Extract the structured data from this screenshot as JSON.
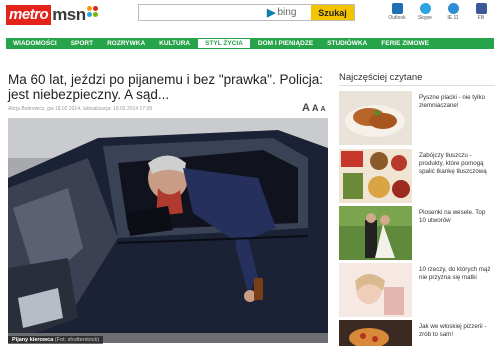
{
  "header": {
    "logo_part1": "metro",
    "logo_part2": "msn",
    "search_placeholder": "",
    "bing_label": "bing",
    "search_button": "Szukaj",
    "quick_links": [
      {
        "label": "Outlook",
        "icon": "outlook-icon",
        "color": "#1f6fb5"
      },
      {
        "label": "Skype",
        "icon": "skype-icon",
        "color": "#2ca4de"
      },
      {
        "label": "IE 11",
        "icon": "ie-icon",
        "color": "#2e8fd6"
      },
      {
        "label": "FB",
        "icon": "facebook-icon",
        "color": "#3b5998"
      }
    ]
  },
  "nav": {
    "items": [
      "WIADOMOŚCI",
      "SPORT",
      "ROZRYWKA",
      "KULTURA",
      "STYL ŻYCIA",
      "DOM I PIENIĄDZE",
      "STUDIÓWKA",
      "FERIE ZIMOWE"
    ],
    "active_index": 4,
    "color": "#27a34a"
  },
  "article": {
    "headline": "Ma 60 lat, jeździ po pijanemu i bez \"prawka\". Policja: jest niebezpieczny. A sąd...",
    "meta": "Alicja Bobrowicz, gw    18.02.2014, /aktualizacja: 18.02.2014 17:39",
    "font_size_control": "A",
    "photo_caption": "Pijany kierowca",
    "photo_credit": "(Fot. shutterstock)"
  },
  "sidebar": {
    "title": "Najczęściej czytane",
    "items": [
      {
        "text": "Pyszne placki - nie tylko ziemniaczane!",
        "thumb": "food-thumbnail"
      },
      {
        "text": "Zabójczy tłuszczu - produkty, które pomogą spalić tkankę tłuszczową",
        "thumb": "healthy-food-thumbnail"
      },
      {
        "text": "Piosenki na wesele. Top 10 utworów",
        "thumb": "wedding-thumbnail"
      },
      {
        "text": "10 rzeczy, do których mąż nie przyzna się matki",
        "thumb": "woman-thumbnail"
      },
      {
        "text": "Jak we włoskiej pizzerii - zrób to sam!",
        "thumb": "pizza-thumbnail"
      }
    ]
  }
}
